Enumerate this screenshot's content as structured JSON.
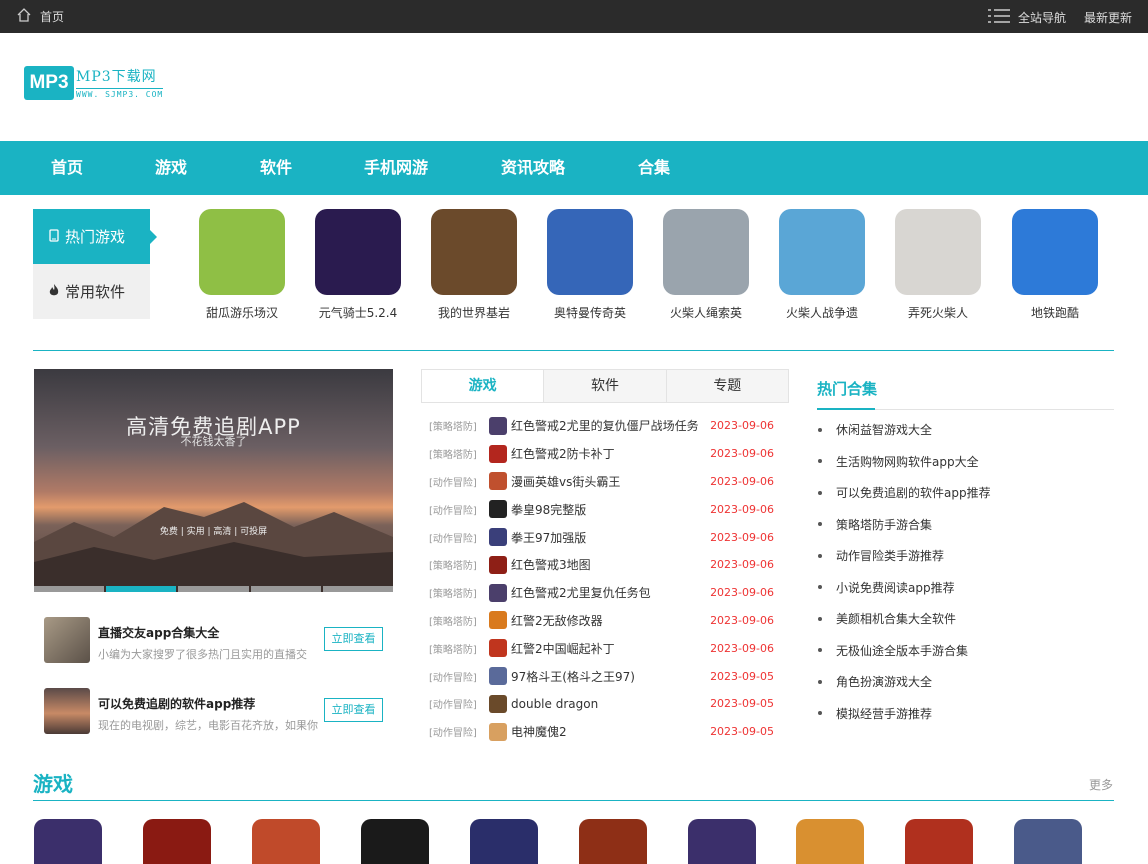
{
  "topbar": {
    "home": "首页",
    "nav_all": "全站导航",
    "latest": "最新更新"
  },
  "logo": {
    "box": "MP3",
    "name": "MP3下载网",
    "url": "WWW. SJMP3. COM"
  },
  "main_nav": [
    "首页",
    "游戏",
    "软件",
    "手机网游",
    "资讯攻略",
    "合集"
  ],
  "side_tabs": {
    "hot": "热门游戏",
    "soft": "常用软件"
  },
  "hot_games": [
    {
      "name": "甜瓜游乐场汉",
      "color": "#8fbf45"
    },
    {
      "name": "元气骑士5.2.4",
      "color": "#2a1b4f"
    },
    {
      "name": "我的世界基岩",
      "color": "#6b4a2b"
    },
    {
      "name": "奥特曼传奇英",
      "color": "#3566b8"
    },
    {
      "name": "火柴人绳索英",
      "color": "#9aa4ad"
    },
    {
      "name": "火柴人战争遗",
      "color": "#5aa6d6"
    },
    {
      "name": "弄死火柴人",
      "color": "#d8d6d2"
    },
    {
      "name": "地铁跑酷",
      "color": "#2d7ad8"
    }
  ],
  "banner": {
    "title": "高清免费追剧APP",
    "subtitle": "不花钱太香了",
    "tagline": "免费 | 实用 | 高清 | 可投屏"
  },
  "recommend": [
    {
      "title": "直播交友app合集大全",
      "desc": "小编为大家搜罗了很多热门且实用的直播交",
      "button": "立即查看"
    },
    {
      "title": "可以免费追剧的软件app推荐",
      "desc": "现在的电视剧，综艺，电影百花齐放，如果你",
      "button": "立即查看"
    }
  ],
  "mid_tabs": [
    "游戏",
    "软件",
    "专题"
  ],
  "news": [
    {
      "cat": "[策略塔防]",
      "title": "红色警戒2尤里的复仇僵尸战场任务",
      "date": "2023-09-06",
      "icon_color": "#4b3f6b"
    },
    {
      "cat": "[策略塔防]",
      "title": "红色警戒2防卡补丁",
      "date": "2023-09-06",
      "icon_color": "#b3261e"
    },
    {
      "cat": "[动作冒险]",
      "title": "漫画英雄vs街头霸王",
      "date": "2023-09-06",
      "icon_color": "#c0502e"
    },
    {
      "cat": "[动作冒险]",
      "title": "拳皇98完整版",
      "date": "2023-09-06",
      "icon_color": "#222222"
    },
    {
      "cat": "[动作冒险]",
      "title": "拳王97加强版",
      "date": "2023-09-06",
      "icon_color": "#3a3f7a"
    },
    {
      "cat": "[策略塔防]",
      "title": "红色警戒3地图",
      "date": "2023-09-06",
      "icon_color": "#8e1f16"
    },
    {
      "cat": "[策略塔防]",
      "title": "红色警戒2尤里复仇任务包",
      "date": "2023-09-06",
      "icon_color": "#4b3f6b"
    },
    {
      "cat": "[策略塔防]",
      "title": "红警2无敌修改器",
      "date": "2023-09-06",
      "icon_color": "#d97a1e"
    },
    {
      "cat": "[策略塔防]",
      "title": "红警2中国崛起补丁",
      "date": "2023-09-06",
      "icon_color": "#c0351e"
    },
    {
      "cat": "[动作冒险]",
      "title": "97格斗王(格斗之王97)",
      "date": "2023-09-05",
      "icon_color": "#5a6a9a"
    },
    {
      "cat": "[动作冒险]",
      "title": "double dragon",
      "date": "2023-09-05",
      "icon_color": "#6a4a2a"
    },
    {
      "cat": "[动作冒险]",
      "title": "电神魔傀2",
      "date": "2023-09-05",
      "icon_color": "#d8a060"
    }
  ],
  "hot_collections": {
    "title": "热门合集",
    "items": [
      "休闲益智游戏大全",
      "生活购物网购软件app大全",
      "可以免费追剧的软件app推荐",
      "策略塔防手游合集",
      "动作冒险类手游推荐",
      "小说免费阅读app推荐",
      "美颜相机合集大全软件",
      "无极仙途全版本手游合集",
      "角色扮演游戏大全",
      "模拟经营手游推荐"
    ]
  },
  "games_section": {
    "title": "游戏",
    "more": "更多"
  },
  "bottom_icon_colors": [
    "#3b2f6b",
    "#8a1a12",
    "#c04a2a",
    "#1a1a1a",
    "#2a2e6a",
    "#8e2f16",
    "#3b2f6b",
    "#d99030",
    "#b0301e",
    "#4a5a8a"
  ]
}
